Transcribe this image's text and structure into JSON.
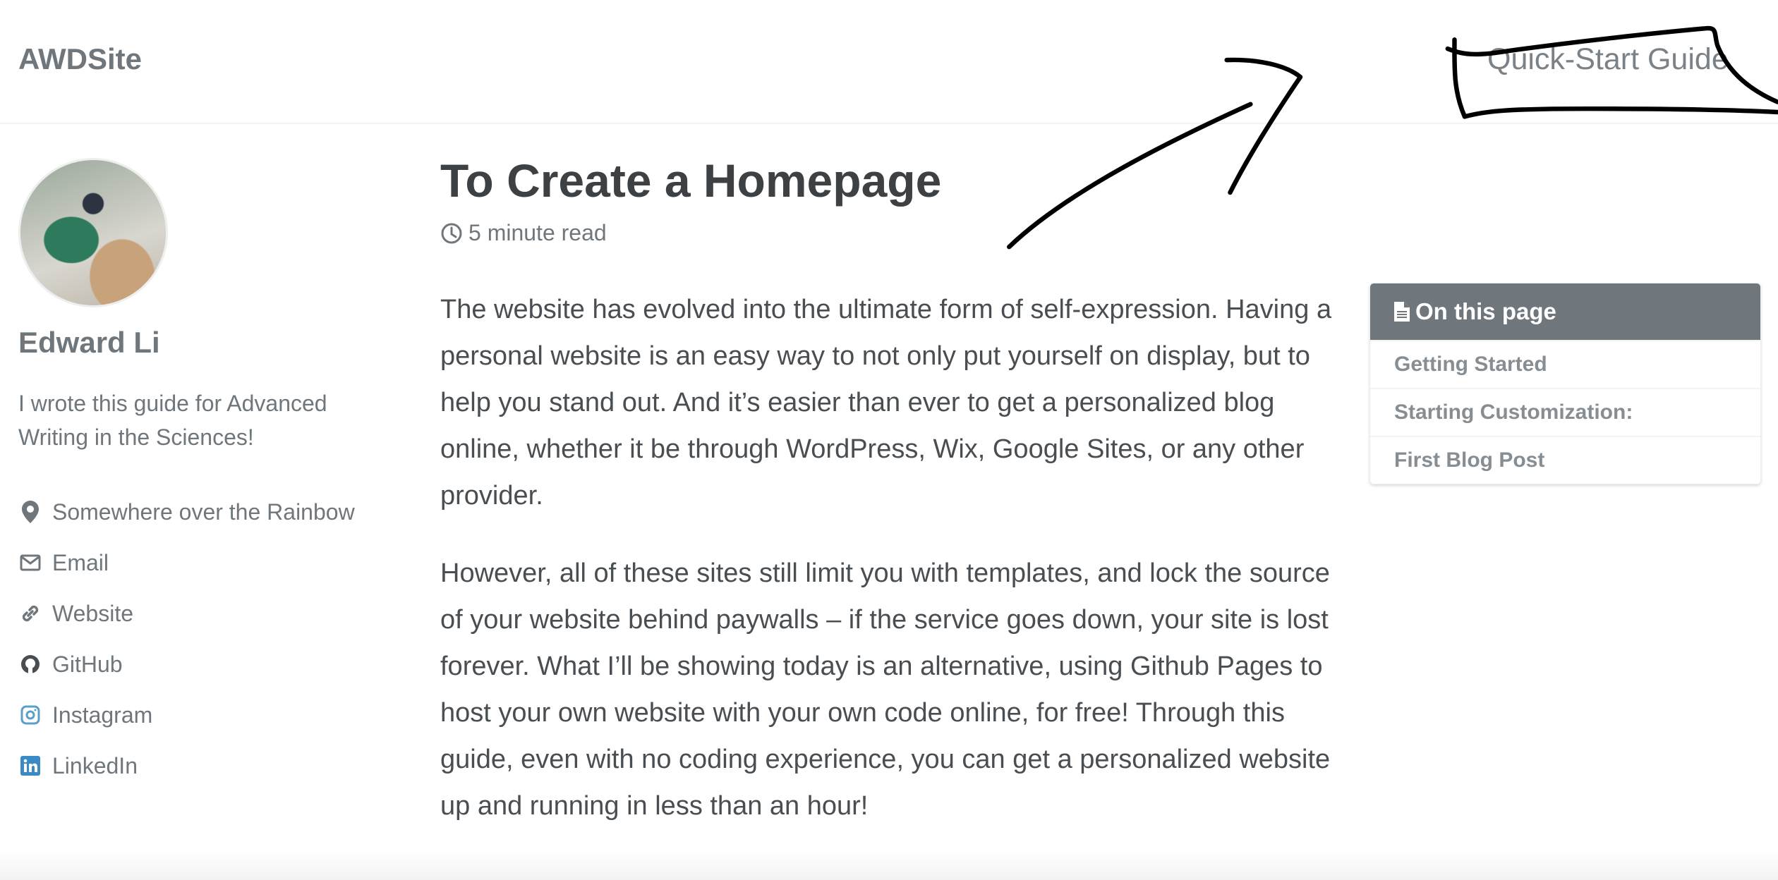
{
  "header": {
    "site_title": "AWDSite",
    "nav": [
      "Quick-Start Guide"
    ]
  },
  "author": {
    "name": "Edward Li",
    "bio": "I wrote this guide for Advanced Writing in the Sciences!",
    "links": [
      {
        "icon": "map-marker-icon",
        "label": "Somewhere over the Rainbow"
      },
      {
        "icon": "envelope-icon",
        "label": "Email"
      },
      {
        "icon": "link-icon",
        "label": "Website"
      },
      {
        "icon": "github-icon",
        "label": "GitHub"
      },
      {
        "icon": "instagram-icon",
        "label": "Instagram"
      },
      {
        "icon": "linkedin-icon",
        "label": "LinkedIn"
      }
    ]
  },
  "article": {
    "title": "To Create a Homepage",
    "read_time": "5 minute read",
    "paragraphs": [
      "The website has evolved into the ultimate form of self-expression. Having a personal website is an easy way to not only put yourself on display, but to help you stand out. And it’s easier than ever to get a personalized blog online, whether it be through WordPress, Wix, Google Sites, or any other provider.",
      "However, all of these sites still limit you with templates, and lock the source of your website behind paywalls – if the service goes down, your site is lost forever. What I’ll be showing today is an alternative, using Github Pages to host your own website with your own code online, for free! Through this guide, even with no coding experience, you can get a personalized website up and running in less than an hour!"
    ]
  },
  "toc": {
    "title": "On this page",
    "items": [
      "Getting Started",
      "Starting Customization:",
      "First Blog Post"
    ]
  },
  "colors": {
    "accent": "#6f777d",
    "linkedin": "#3a8bc5",
    "instagram": "#5a9fc9"
  }
}
